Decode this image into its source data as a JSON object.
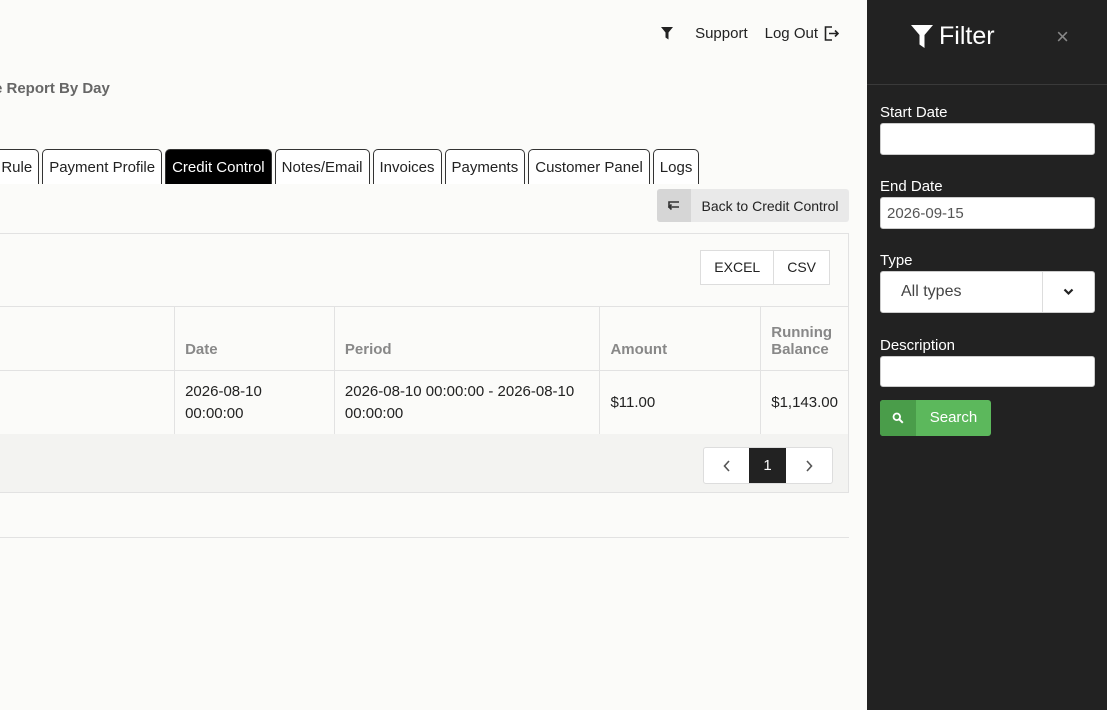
{
  "topnav": {
    "support": "Support",
    "logout": "Log Out"
  },
  "page": {
    "title": "e Report By Day"
  },
  "tabs": [
    {
      "label": "tion Rule",
      "active": false
    },
    {
      "label": "Payment Profile",
      "active": false
    },
    {
      "label": "Credit Control",
      "active": true
    },
    {
      "label": "Notes/Email",
      "active": false
    },
    {
      "label": "Invoices",
      "active": false
    },
    {
      "label": "Payments",
      "active": false
    },
    {
      "label": "Customer Panel",
      "active": false
    },
    {
      "label": "Logs",
      "active": false
    }
  ],
  "back_button": {
    "label": "Back to Credit Control"
  },
  "export": {
    "excel": "EXCEL",
    "csv": "CSV"
  },
  "table": {
    "headers": {
      "date": "Date",
      "period": "Period",
      "amount": "Amount",
      "running_balance_1": "Running",
      "running_balance_2": "Balance"
    },
    "rows": [
      {
        "date": "2026-08-10 00:00:00",
        "period": "2026-08-10 00:00:00 - 2026-08-10 00:00:00",
        "amount": "$11.00",
        "running_balance": "$1,143.00"
      }
    ]
  },
  "pagination": {
    "current": "1"
  },
  "filter": {
    "title": "Filter",
    "close": "×",
    "start_date_label": "Start Date",
    "start_date_value": "",
    "end_date_label": "End Date",
    "end_date_value": "2026-09-15",
    "type_label": "Type",
    "type_value": "All types",
    "description_label": "Description",
    "description_value": "",
    "search_label": "Search"
  },
  "colors": {
    "sidebar_bg": "#222222",
    "active_tab": "#000000",
    "search_green": "#5cb85c"
  }
}
